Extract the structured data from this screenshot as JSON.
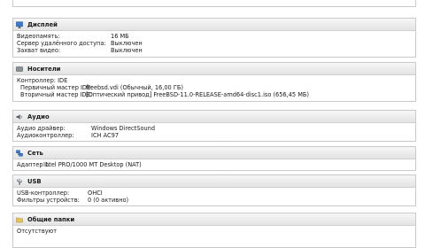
{
  "sections": [
    {
      "title": "Дисплей",
      "icon": "display-icon",
      "rows": [
        {
          "key": "Видеопамять:",
          "value": "16 МБ"
        },
        {
          "key": "Сервер удалённого доступа:",
          "value": "Выключен"
        },
        {
          "key": "Захват видео:",
          "value": "Выключен"
        }
      ]
    },
    {
      "title": "Носители",
      "icon": "storage-icon",
      "rows": [
        {
          "key": "Контроллер: IDE",
          "value": ""
        },
        {
          "key": "Первичный мастер IDE:",
          "value": "freebsd.vdi (Обычный, 16,00 ГБ)"
        },
        {
          "key": "Вторичный мастер IDE:",
          "value": "[Оптический привод] FreeBSD-11.0-RELEASE-amd64-disc1.iso (656,45 МБ)"
        }
      ]
    },
    {
      "title": "Аудио",
      "icon": "audio-icon",
      "rows": [
        {
          "key": "Аудио драйвер:",
          "value": "Windows DirectSound"
        },
        {
          "key": "Аудиоконтроллер:",
          "value": "ICH AC97"
        }
      ]
    },
    {
      "title": "Сеть",
      "icon": "network-icon",
      "rows": [
        {
          "key": "Адаптер 1:",
          "value": "Intel PRO/1000 MT Desktop (NAT)"
        }
      ]
    },
    {
      "title": "USB",
      "icon": "usb-icon",
      "rows": [
        {
          "key": "USB-контроллер:",
          "value": "OHCI"
        },
        {
          "key": "Фильтры устройств:",
          "value": "0 (0 активно)"
        }
      ]
    },
    {
      "title": "Общие папки",
      "icon": "shared-folders-icon",
      "rows": [
        {
          "key": "Отсутствуют",
          "value": ""
        }
      ]
    }
  ]
}
